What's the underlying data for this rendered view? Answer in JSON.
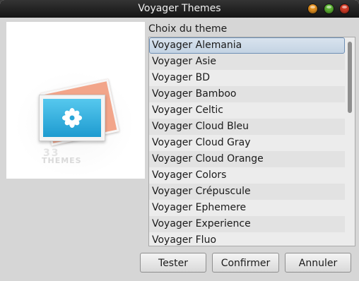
{
  "window": {
    "title": "Voyager Themes"
  },
  "preview": {
    "brand_number": "33",
    "brand_name": "THEMES"
  },
  "list": {
    "label": "Choix du theme",
    "items": [
      {
        "label": "Voyager Alemania",
        "selected": true
      },
      {
        "label": "Voyager Asie"
      },
      {
        "label": "Voyager BD"
      },
      {
        "label": "Voyager Bamboo"
      },
      {
        "label": "Voyager Celtic"
      },
      {
        "label": "Voyager Cloud Bleu"
      },
      {
        "label": "Voyager Cloud Gray"
      },
      {
        "label": "Voyager Cloud Orange"
      },
      {
        "label": "Voyager Colors"
      },
      {
        "label": "Voyager Crépuscule"
      },
      {
        "label": "Voyager Ephemere"
      },
      {
        "label": "Voyager Experience"
      },
      {
        "label": "Voyager Fluo"
      }
    ]
  },
  "buttons": {
    "tester": "Tester",
    "confirm": "Confirmer",
    "cancel": "Annuler"
  },
  "colors": {
    "selection": "#c4d3e3",
    "titlebar": "#1e1e1e",
    "minimize": "#e3901f",
    "maximize": "#5cb232",
    "close": "#d23b26"
  }
}
